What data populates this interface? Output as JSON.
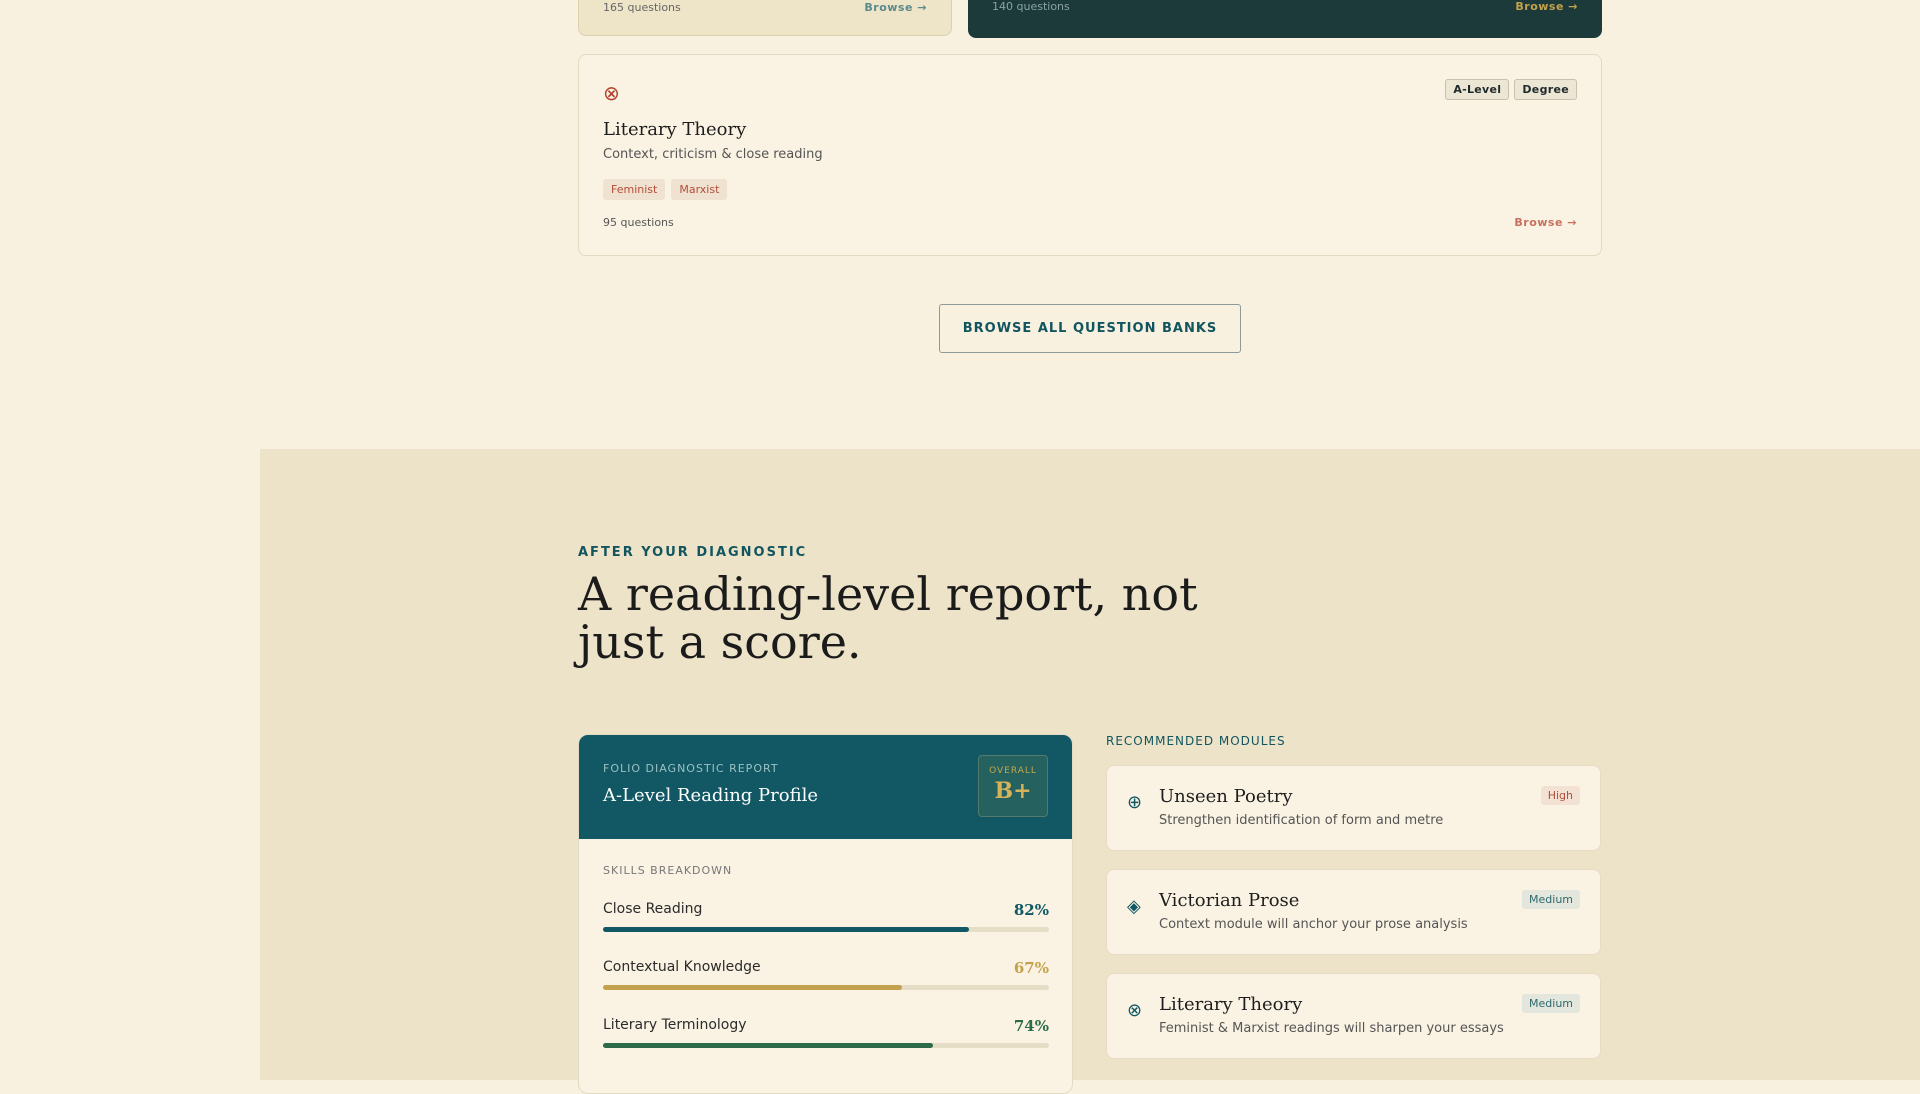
{
  "top_cards": {
    "left": {
      "count": "165 questions",
      "browse": "Browse →"
    },
    "right": {
      "count": "140 questions",
      "browse": "Browse →"
    }
  },
  "literary_theory": {
    "icon": "⊗",
    "levels": [
      "A-Level",
      "Degree"
    ],
    "title": "Literary Theory",
    "subtitle": "Context, criticism & close reading",
    "tags": [
      "Feminist",
      "Marxist"
    ],
    "count": "95 questions",
    "browse": "Browse →"
  },
  "browse_all": "BROWSE ALL QUESTION BANKS",
  "section": {
    "eyebrow": "AFTER YOUR DIAGNOSTIC",
    "headline": "A reading-level report, not just a score."
  },
  "report": {
    "kicker": "FOLIO DIAGNOSTIC REPORT",
    "title": "A-Level Reading Profile",
    "overall_label": "OVERALL",
    "overall_grade": "B+",
    "skills_label": "SKILLS BREAKDOWN",
    "skills": [
      {
        "name": "Close Reading",
        "value": "82%",
        "level": 0.82,
        "color": "#115864"
      },
      {
        "name": "Contextual Knowledge",
        "value": "67%",
        "level": 0.67,
        "color": "#c4a14c"
      },
      {
        "name": "Literary Terminology",
        "value": "74%",
        "level": 0.74,
        "color": "#2d6b4a"
      }
    ]
  },
  "recommended": {
    "label": "RECOMMENDED MODULES",
    "modules": [
      {
        "icon": "⊕",
        "title": "Unseen Poetry",
        "desc": "Strengthen identification of form and metre",
        "priority": "High",
        "priority_color": "#b44e3a",
        "priority_bg": "#f3e2d4"
      },
      {
        "icon": "◈",
        "title": "Victorian Prose",
        "desc": "Context module will anchor your prose analysis",
        "priority": "Medium",
        "priority_color": "#2f6a6e",
        "priority_bg": "#e3e6dc"
      },
      {
        "icon": "⊗",
        "title": "Literary Theory",
        "desc": "Feminist & Marxist readings will sharpen your essays",
        "priority": "Medium",
        "priority_color": "#2f6a6e",
        "priority_bg": "#e3e6dc"
      }
    ]
  }
}
